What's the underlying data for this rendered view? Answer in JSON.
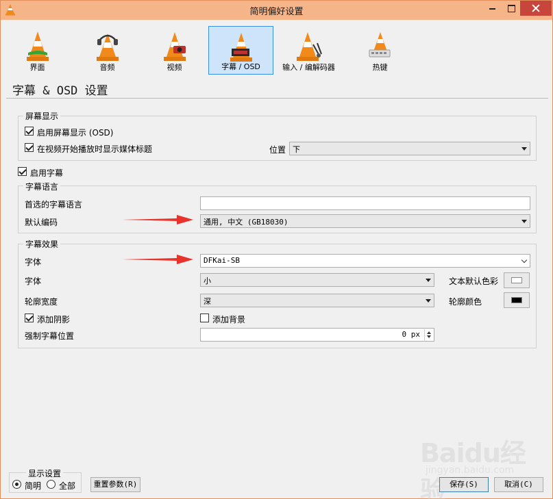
{
  "window": {
    "title": "简明偏好设置"
  },
  "categories": [
    {
      "label": "界面",
      "icon": "interface-cone-icon",
      "selected": false
    },
    {
      "label": "音频",
      "icon": "audio-cone-icon",
      "selected": false
    },
    {
      "label": "视频",
      "icon": "video-cone-icon",
      "selected": false
    },
    {
      "label": "字幕 / OSD",
      "icon": "subtitle-osd-cone-icon",
      "selected": true
    },
    {
      "label": "输入 / 编解码器",
      "icon": "input-codec-cone-icon",
      "selected": false
    },
    {
      "label": "热键",
      "icon": "hotkeys-cone-icon",
      "selected": false
    }
  ],
  "section": {
    "title": "字幕 & OSD 设置"
  },
  "osd_group": {
    "title": "屏幕显示",
    "enable_osd": {
      "label": "启用屏幕显示 (OSD)",
      "checked": true
    },
    "show_title": {
      "label": "在视频开始播放时显示媒体标题",
      "checked": true
    },
    "position_label": "位置",
    "position_value": "下"
  },
  "enable_subtitles": {
    "label": "启用字幕",
    "checked": true
  },
  "subtitle_language": {
    "title": "字幕语言",
    "preferred_label": "首选的字幕语言",
    "preferred_value": "",
    "encoding_label": "默认编码",
    "encoding_value": "通用, 中文 (GB18030)"
  },
  "subtitle_effects": {
    "title": "字幕效果",
    "font_label": "字体",
    "font_value": "DFKai-SB",
    "size_label": "字体",
    "size_value": "小",
    "text_color_label": "文本默认色彩",
    "text_color": "#ffffff",
    "outline_label": "轮廓宽度",
    "outline_value": "深",
    "outline_color_label": "轮廓颜色",
    "outline_color": "#000000",
    "shadow": {
      "label": "添加阴影",
      "checked": true
    },
    "background": {
      "label": "添加背景",
      "checked": false
    },
    "force_position_label": "强制字幕位置",
    "force_position_value": "0 px"
  },
  "display_settings": {
    "title": "显示设置",
    "simple_label": "简明",
    "simple_checked": true,
    "all_label": "全部",
    "all_checked": false
  },
  "buttons": {
    "reset": "重置参数(R)",
    "save": "保存(S)",
    "cancel": "取消(C)"
  },
  "watermark": {
    "text": "Baidu经验",
    "sub": "jingyan.baidu.com"
  },
  "colors": {
    "title_bar": "#f6b489",
    "close_button": "#c7453b",
    "selected_category": "#cde4fb",
    "annotation_arrow": "#e8322c"
  }
}
